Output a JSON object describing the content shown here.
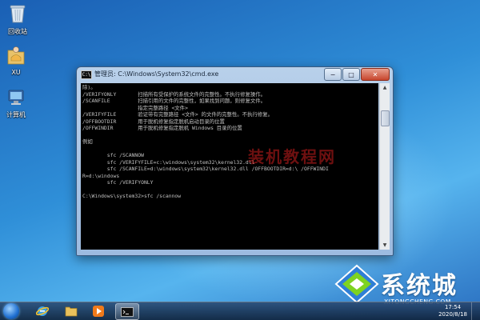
{
  "desktop": {
    "icons": [
      {
        "label": "回收站",
        "icon": "recycle-bin-icon"
      },
      {
        "label": "XU",
        "icon": "user-folder-icon"
      },
      {
        "label": "计算机",
        "icon": "computer-icon"
      }
    ]
  },
  "window": {
    "title": "管理员: C:\\Windows\\System32\\cmd.exe",
    "title_icon_text": "C:\\",
    "buttons": {
      "minimize": "−",
      "maximize": "□",
      "close": "✕"
    },
    "console_lines": [
      "除)。",
      "/VERIFYONLY       扫描所有受保护的系统文件的完整性。不执行修复操作。",
      "/SCANFILE         扫描引用的文件的完整性，如果找到问题，则修复文件。",
      "                  指定完整路径 <文件>",
      "/VERIFYFILE       验证带有完整路径 <文件> 的文件的完整性。不执行修复。",
      "/OFFBOOTDIR       用于脱机修复指定脱机启动目录的位置",
      "/OFFWINDIR        用于脱机修复指定脱机 Windows 目录的位置",
      "",
      "例如",
      "",
      "        sfc /SCANNOW",
      "        sfc /VERIFYFILE=c:\\windows\\system32\\kernel32.dll",
      "        sfc /SCANFILE=d:\\windows\\system32\\kernel32.dll /OFFBOOTDIR=d:\\ /OFFWINDI",
      "R=d:\\windows",
      "        sfc /VERIFYONLY",
      "",
      "C:\\Windows\\system32>sfc /scannow"
    ],
    "overlay_watermark": "装机教程网"
  },
  "branding": {
    "name": "系统城",
    "url": "XITONGCHENG.COM"
  },
  "colors": {
    "console_bg": "#000000",
    "console_text": "#c0c0c0",
    "brand_accent": "#7ed321",
    "desktop_blue": "#2f8fd8"
  },
  "taskbar": {
    "items": [
      {
        "icon": "internet-explorer-icon",
        "active": false
      },
      {
        "icon": "folder-icon",
        "active": false
      },
      {
        "icon": "media-player-icon",
        "active": false
      },
      {
        "icon": "command-prompt-icon",
        "active": true
      }
    ],
    "clock_time": "17:54",
    "clock_date": "2020/8/18"
  }
}
